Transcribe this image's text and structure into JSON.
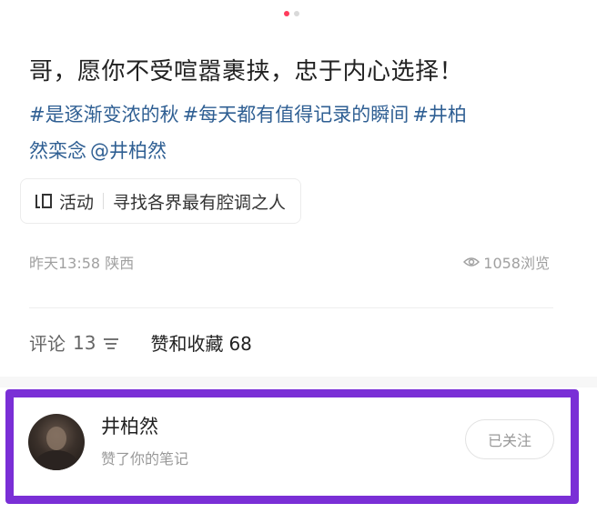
{
  "carousel": {
    "dot_count": 2,
    "active_index": 0,
    "active_color": "#ff3b5c"
  },
  "post": {
    "title": "哥，愿你不受喧嚣裹挟，忠于内心选择！",
    "hashtags": [
      "#是逐渐变浓的秋",
      "#每天都有值得记录的瞬间",
      "#井柏",
      "然栾念",
      "@井柏然"
    ],
    "activity": {
      "icon": "activity-icon",
      "label": "活动",
      "text": "寻找各界最有腔调之人"
    },
    "time": "昨天13:58",
    "location": "陕西",
    "views": "1058浏览"
  },
  "tabs": {
    "comments_label": "评论",
    "comments_count": "13",
    "likes_label": "赞和收藏",
    "likes_count": "68"
  },
  "notification": {
    "user_name": "井柏然",
    "action_text": "赞了你的笔记",
    "follow_label": "已关注",
    "highlight_color": "#7a2fd6"
  }
}
